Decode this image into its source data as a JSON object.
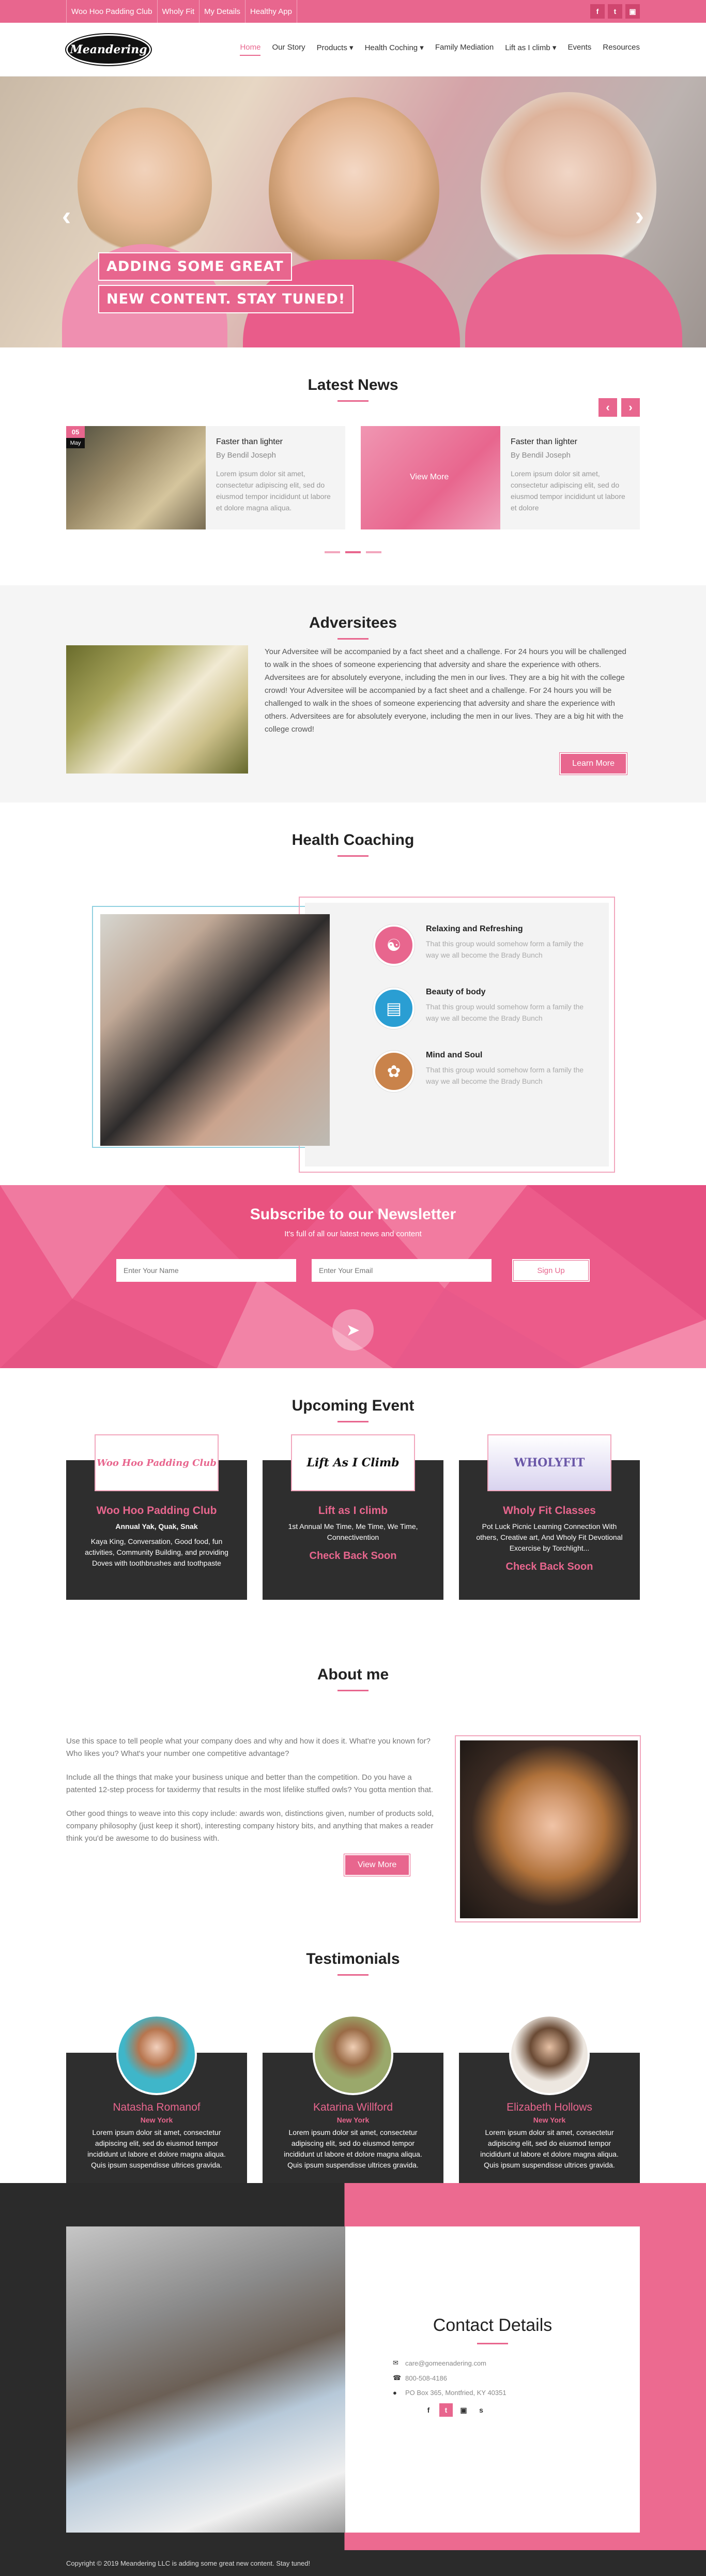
{
  "topbar": {
    "links": [
      "Woo Hoo Padding Club",
      "Wholy Fit",
      "My Details",
      "Healthy App"
    ],
    "social": [
      {
        "icon": "facebook-icon",
        "glyph": "f"
      },
      {
        "icon": "twitter-icon",
        "glyph": "t"
      },
      {
        "icon": "instagram-icon",
        "glyph": "▣"
      }
    ]
  },
  "header": {
    "logo_text": "Meandering",
    "menu": [
      "Home",
      "Our Story",
      "Products ▾",
      "Health Coching ▾",
      "Family Mediation",
      "Lift as I climb ▾",
      "Events",
      "Resources"
    ]
  },
  "hero": {
    "caption_line1": "ADDING SOME GREAT",
    "caption_line2": "NEW CONTENT. STAY TUNED!",
    "prev_glyph": "‹",
    "next_glyph": "›"
  },
  "news": {
    "title": "Latest News",
    "prev_glyph": "‹",
    "next_glyph": "›",
    "cards": [
      {
        "day": "05",
        "month": "May",
        "view_more": "",
        "title": "Faster than lighter",
        "author": "By Bendil Joseph",
        "excerpt": "Lorem ipsum dolor sit amet, consectetur adipiscing elit, sed do eiusmod tempor incididunt ut labore et dolore magna aliqua."
      },
      {
        "day": "",
        "month": "",
        "view_more": "View More",
        "title": "Faster than lighter",
        "author": "By Bendil Joseph",
        "excerpt": "Lorem ipsum dolor sit amet, consectetur adipiscing elit, sed do eiusmod tempor incididunt ut labore et dolore"
      }
    ]
  },
  "adversitees": {
    "title": "Adversitees",
    "body": "Your Adversitee will be accompanied by a fact sheet and a challenge.  For 24 hours you will be challenged to walk in the shoes of someone experiencing that adversity and share the experience with others. Adversitees are for absolutely everyone, including the men in our lives.  They are a big hit with the college crowd! Your Adversitee will be accompanied by a fact sheet and a challenge.  For 24 hours you will be challenged to walk in the shoes of someone experiencing that adversity and share the experience with others. Adversitees are for absolutely everyone, including the men in our lives.  They are a big hit with the college crowd!",
    "button": "Learn More"
  },
  "health_coaching": {
    "title": "Health Coaching",
    "items": [
      {
        "icon": "meditation-icon",
        "glyph": "☯",
        "color": "#e8668e",
        "title": "Relaxing and Refreshing",
        "text": "That this group would somehow form a family the way we all become the Brady Bunch"
      },
      {
        "icon": "scale-icon",
        "glyph": "▤",
        "color": "#2a9ed3",
        "title": "Beauty of body",
        "text": "That this group would somehow form a family the way we all become the Brady Bunch"
      },
      {
        "icon": "mind-icon",
        "glyph": "✿",
        "color": "#c9834b",
        "title": "Mind and Soul",
        "text": "That this group would somehow form a family the way we all become the Brady Bunch"
      }
    ]
  },
  "newsletter": {
    "title": "Subscribe to our Newsletter",
    "lead": "It's full of all our latest news and content",
    "name_placeholder": "Enter Your Name",
    "email_placeholder": "Enter Your Email",
    "button": "Sign Up",
    "plane_glyph": "➤"
  },
  "events": {
    "title": "Upcoming Event",
    "cards": [
      {
        "logo": "Woo Hoo Padding Club",
        "name": "Woo Hoo Padding Club",
        "subtitle": "Annual Yak, Quak, Snak",
        "desc": "Kaya King, Conversation, Good food, fun activities, Community Building, and providing Doves with toothbrushes and toothpaste",
        "cta": ""
      },
      {
        "logo": "Lift As I Climb",
        "name": "Lift as I climb",
        "subtitle": "",
        "desc": "1st Annual Me Time, Me Time, We Time, Connectivention",
        "cta": "Check Back Soon"
      },
      {
        "logo": "WHOLYFIT",
        "name": "Wholy Fit Classes",
        "subtitle": "",
        "desc": "Pot Luck Picnic Learning Connection With others, Creative art, And Wholy Fit Devotional Excercise by Torchlight...",
        "cta": "Check Back Soon"
      }
    ]
  },
  "about": {
    "title": "About me",
    "paragraphs": [
      "Use this space to tell people what your company does and why and how it does it. What're you known for? Who likes you? What's your number one competitive advantage?",
      "Include all the things that make your business unique and better than the competition. Do you have a patented 12-step process for taxidermy that results in the most lifelike stuffed owls? You gotta mention that.",
      "Other good things to weave into this copy include: awards won, distinctions given, number of products sold, company philosophy (just keep it short), interesting company history bits, and anything that makes a reader think you'd be awesome to do business with."
    ],
    "button": "View More"
  },
  "testimonials": {
    "title": "Testimonials",
    "cards": [
      {
        "name": "Natasha Romanof",
        "location": "New York",
        "text": "Lorem ipsum dolor sit amet, consectetur adipiscing elit, sed do eiusmod tempor incididunt ut labore et dolore magna aliqua. Quis ipsum suspendisse ultrices gravida.",
        "avatar_color": "#3fb6c9"
      },
      {
        "name": "Katarina Willford",
        "location": "New York",
        "text": "Lorem ipsum dolor sit amet, consectetur adipiscing elit, sed do eiusmod tempor incididunt ut labore et dolore magna aliqua. Quis ipsum suspendisse ultrices gravida.",
        "avatar_color": "#9aa86b"
      },
      {
        "name": "Elizabeth Hollows",
        "location": "New York",
        "text": "Lorem ipsum dolor sit amet, consectetur adipiscing elit, sed do eiusmod tempor incididunt ut labore et dolore magna aliqua. Quis ipsum suspendisse ultrices gravida.",
        "avatar_color": "#8a6a52"
      }
    ]
  },
  "contact": {
    "title": "Contact Details",
    "email": "care@gomeenadering.com",
    "phone": "800-508-4186",
    "address": "PO Box 365, Montfried, KY 40351",
    "social": [
      {
        "icon": "facebook-icon",
        "glyph": "f"
      },
      {
        "icon": "twitter-icon",
        "glyph": "t"
      },
      {
        "icon": "instagram-icon",
        "glyph": "▣"
      },
      {
        "icon": "skype-icon",
        "glyph": "s"
      }
    ]
  },
  "footer": {
    "copyright": "Copyright © 2019 Meandering LLC is adding some great new content. Stay tuned!"
  },
  "colors": {
    "accent": "#e8668e",
    "dark": "#2e2e2e"
  }
}
